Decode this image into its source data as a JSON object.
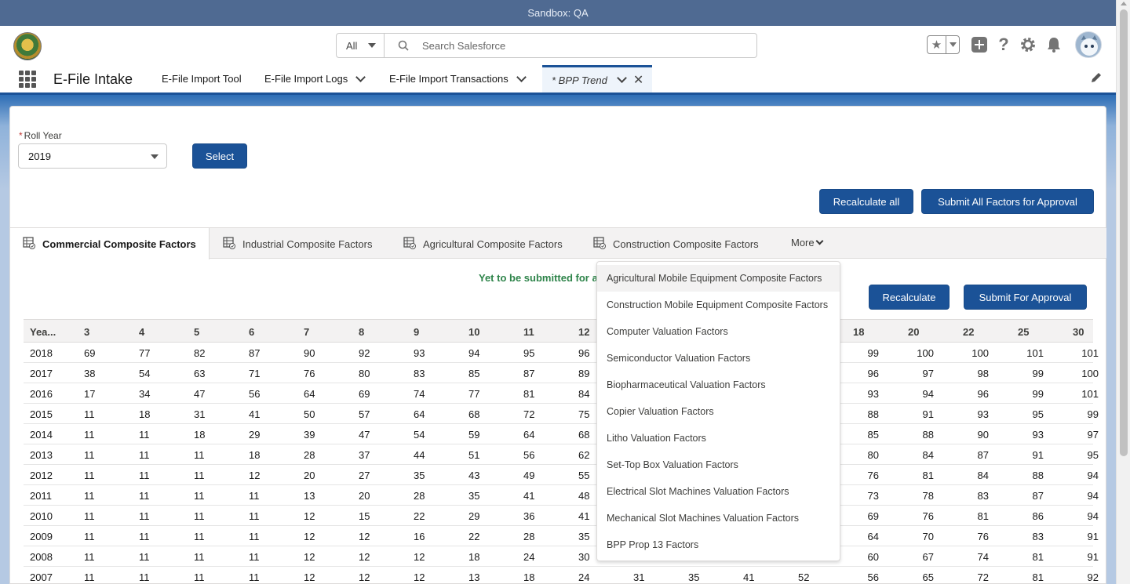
{
  "sandbox_label": "Sandbox: QA",
  "header": {
    "search_scope": "All",
    "search_placeholder": "Search Salesforce"
  },
  "nav": {
    "app_name": "E-File Intake",
    "items": [
      {
        "label": "E-File Import Tool"
      },
      {
        "label": "E-File Import Logs"
      },
      {
        "label": "E-File Import Transactions"
      }
    ],
    "active_tab": "* BPP Trend"
  },
  "form": {
    "roll_year_label": "Roll Year",
    "roll_year_required": "*",
    "roll_year_value": "2019",
    "select_button": "Select"
  },
  "actions": {
    "recalculate_all": "Recalculate all",
    "submit_all": "Submit All Factors for Approval",
    "recalculate": "Recalculate",
    "submit_for_approval": "Submit For Approval"
  },
  "tabs": [
    {
      "label": "Commercial Composite Factors"
    },
    {
      "label": "Industrial Composite Factors"
    },
    {
      "label": "Agricultural Composite Factors"
    },
    {
      "label": "Construction Composite Factors"
    }
  ],
  "more_label": "More",
  "status_text": "Yet to be submitted for a",
  "table": {
    "headers": [
      "Yea...",
      "3",
      "4",
      "5",
      "6",
      "7",
      "8",
      "9",
      "10",
      "11",
      "12",
      "",
      "",
      "",
      "",
      "18",
      "20",
      "22",
      "25",
      "30"
    ],
    "rows": [
      [
        "2018",
        "69",
        "77",
        "82",
        "87",
        "90",
        "92",
        "93",
        "94",
        "95",
        "96",
        "",
        "",
        "",
        "",
        "99",
        "100",
        "100",
        "101",
        "101"
      ],
      [
        "2017",
        "38",
        "54",
        "63",
        "71",
        "76",
        "80",
        "83",
        "85",
        "87",
        "89",
        "",
        "",
        "",
        "",
        "96",
        "97",
        "98",
        "99",
        "100"
      ],
      [
        "2016",
        "17",
        "34",
        "47",
        "56",
        "64",
        "69",
        "74",
        "77",
        "81",
        "84",
        "",
        "",
        "",
        "",
        "93",
        "94",
        "96",
        "99",
        "101"
      ],
      [
        "2015",
        "11",
        "18",
        "31",
        "41",
        "50",
        "57",
        "64",
        "68",
        "72",
        "75",
        "",
        "",
        "",
        "",
        "88",
        "91",
        "93",
        "95",
        "99"
      ],
      [
        "2014",
        "11",
        "11",
        "18",
        "29",
        "39",
        "47",
        "54",
        "59",
        "64",
        "68",
        "",
        "",
        "",
        "",
        "85",
        "88",
        "90",
        "93",
        "97"
      ],
      [
        "2013",
        "11",
        "11",
        "11",
        "18",
        "28",
        "37",
        "44",
        "51",
        "56",
        "62",
        "",
        "",
        "",
        "",
        "80",
        "84",
        "87",
        "91",
        "95"
      ],
      [
        "2012",
        "11",
        "11",
        "11",
        "12",
        "20",
        "27",
        "35",
        "43",
        "49",
        "55",
        "",
        "",
        "",
        "",
        "76",
        "81",
        "84",
        "88",
        "94"
      ],
      [
        "2011",
        "11",
        "11",
        "11",
        "11",
        "13",
        "20",
        "28",
        "35",
        "41",
        "48",
        "",
        "",
        "",
        "",
        "73",
        "78",
        "83",
        "87",
        "94"
      ],
      [
        "2010",
        "11",
        "11",
        "11",
        "11",
        "12",
        "15",
        "22",
        "29",
        "36",
        "41",
        "",
        "",
        "",
        "",
        "69",
        "76",
        "81",
        "86",
        "94"
      ],
      [
        "2009",
        "11",
        "11",
        "11",
        "11",
        "12",
        "12",
        "16",
        "22",
        "28",
        "35",
        "",
        "",
        "",
        "",
        "64",
        "70",
        "76",
        "83",
        "91"
      ],
      [
        "2008",
        "11",
        "11",
        "11",
        "11",
        "12",
        "12",
        "12",
        "18",
        "24",
        "30",
        "",
        "",
        "",
        "",
        "60",
        "67",
        "74",
        "81",
        "91"
      ],
      [
        "2007",
        "11",
        "11",
        "11",
        "11",
        "12",
        "12",
        "12",
        "13",
        "18",
        "24",
        "31",
        "35",
        "41",
        "52",
        "56",
        "65",
        "72",
        "81",
        "92"
      ]
    ]
  },
  "menu": [
    "Agricultural Mobile Equipment Composite Factors",
    "Construction Mobile Equipment Composite Factors",
    "Computer Valuation Factors",
    "Semiconductor Valuation Factors",
    "Biopharmaceutical Valuation Factors",
    "Copier Valuation Factors",
    "Litho Valuation Factors",
    "Set-Top Box Valuation Factors",
    "Electrical Slot Machines Valuation Factors",
    "Mechanical Slot Machines Valuation Factors",
    "BPP Prop 13 Factors"
  ],
  "colors": {
    "brand": "#1b5297",
    "status_green": "#2e844a",
    "required_red": "#c23934"
  }
}
